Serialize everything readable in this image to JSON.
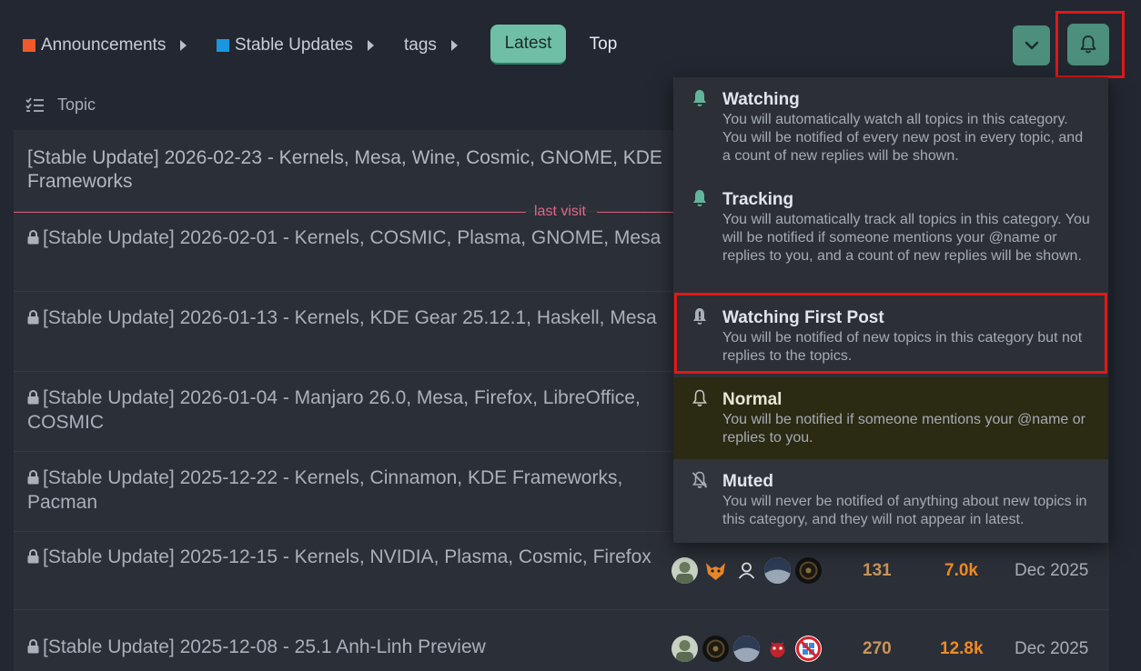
{
  "breadcrumbs": [
    {
      "label": "Announcements",
      "color": "#f05a28"
    },
    {
      "label": "Stable Updates",
      "color": "#1a96e0"
    },
    {
      "label": "tags",
      "color": ""
    }
  ],
  "nav": {
    "latest": "Latest",
    "top": "Top"
  },
  "list_header": {
    "topic": "Topic"
  },
  "last_visit_label": "last visit",
  "topics": [
    {
      "title": "[Stable Update] 2026-02-23 - Kernels, Mesa, Wine, Cosmic, GNOME, KDE Frameworks",
      "locked": false
    },
    {
      "title": "[Stable Update] 2026-02-01 - Kernels, COSMIC, Plasma, GNOME, Mesa",
      "locked": true
    },
    {
      "title": "[Stable Update] 2026-01-13 - Kernels, KDE Gear 25.12.1, Haskell, Mesa",
      "locked": true
    },
    {
      "title": "[Stable Update] 2026-01-04 - Manjaro 26.0, Mesa, Firefox, LibreOffice, COSMIC",
      "locked": true
    },
    {
      "title": "[Stable Update] 2025-12-22 - Kernels, Cinnamon, KDE Frameworks, Pacman",
      "locked": true
    },
    {
      "title": "[Stable Update] 2025-12-15 - Kernels, NVIDIA, Plasma, Cosmic, Firefox",
      "locked": true,
      "replies": "131",
      "views": "7.0k",
      "activity": "Dec 2025"
    },
    {
      "title": "[Stable Update] 2025-12-08 - 25.1 Anh-Linh Preview",
      "locked": true,
      "replies": "270",
      "views": "12.8k",
      "activity": "Dec 2025"
    }
  ],
  "notification_menu": [
    {
      "title": "Watching",
      "desc": "You will automatically watch all topics in this category. You will be notified of every new post in every topic, and a count of new replies will be shown.",
      "icon": "bell-icon"
    },
    {
      "title": "Tracking",
      "desc": "You will automatically track all topics in this category. You will be notified if someone mentions your @name or replies to you, and a count of new replies will be shown.",
      "icon": "bell-icon"
    },
    {
      "title": "Watching First Post",
      "desc": "You will be notified of new topics in this category but not replies to the topics.",
      "icon": "bell-exclamation-icon"
    },
    {
      "title": "Normal",
      "desc": "You will be notified if someone mentions your @name or replies to you.",
      "icon": "bell-outline-icon"
    },
    {
      "title": "Muted",
      "desc": "You will never be notified of anything about new topics in this category, and they will not appear in latest.",
      "icon": "bell-slash-icon"
    }
  ],
  "colors": {
    "accent": "#6fbfa6",
    "bell_button": "#4b8f7c",
    "highlight": "#e01818",
    "last_visit": "#e3668a",
    "views": "#f08a24"
  }
}
